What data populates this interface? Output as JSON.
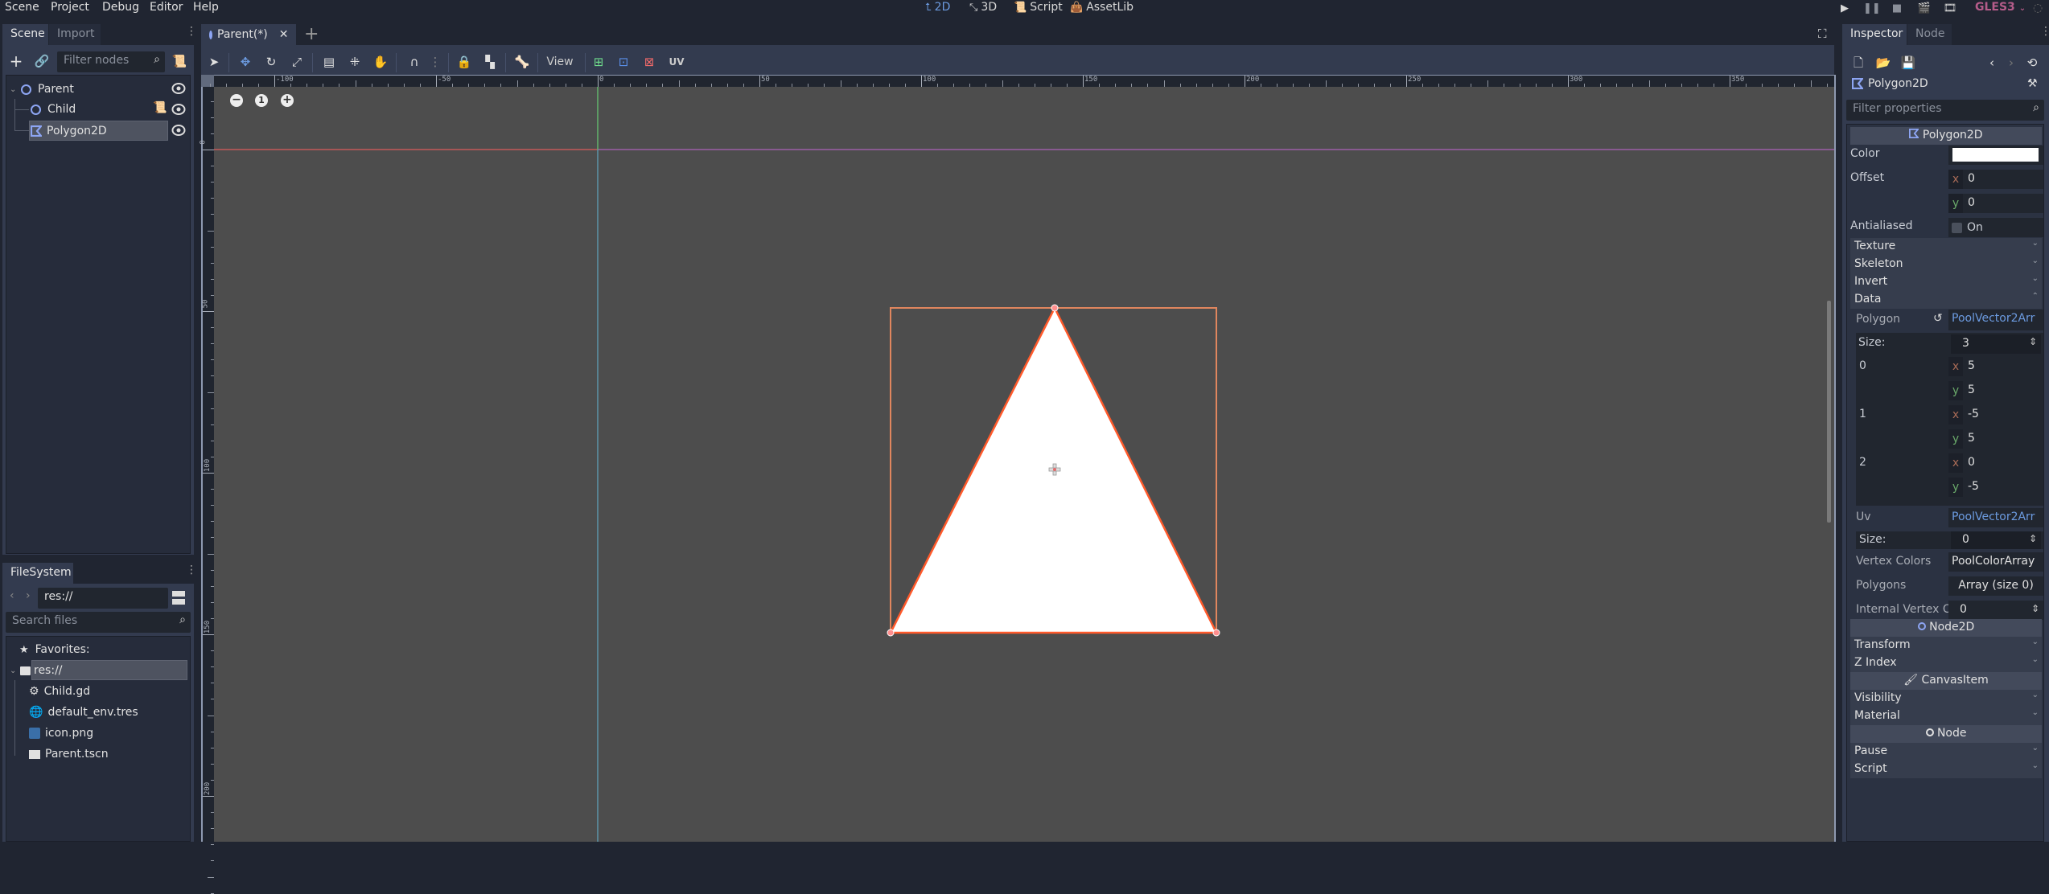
{
  "menubar": {
    "items": [
      "Scene",
      "Project",
      "Debug",
      "Editor",
      "Help"
    ],
    "modes": [
      {
        "label": "2D",
        "icon": "2d-icon",
        "active": true
      },
      {
        "label": "3D",
        "icon": "3d-icon",
        "active": false
      },
      {
        "label": "Script",
        "icon": "script-icon",
        "active": false
      },
      {
        "label": "AssetLib",
        "icon": "assetlib-icon",
        "active": false
      }
    ],
    "run_buttons": [
      "play-icon",
      "pause-icon",
      "stop-icon",
      "play-scene-icon",
      "play-custom-scene-icon"
    ],
    "renderer": "GLES3",
    "accent_color": "#6c9be0",
    "renderer_color": "#b55c8a"
  },
  "scene_dock": {
    "tabs": [
      "Scene",
      "Import"
    ],
    "active_tab": "Scene",
    "filter_placeholder": "Filter nodes",
    "tree": [
      {
        "name": "Parent",
        "type": "Node2D",
        "level": 0,
        "expanded": true,
        "has_script": false,
        "visible": true,
        "selected": false
      },
      {
        "name": "Child",
        "type": "Node2D",
        "level": 1,
        "has_script": true,
        "visible": true,
        "selected": false
      },
      {
        "name": "Polygon2D",
        "type": "Polygon2D",
        "level": 1,
        "has_script": false,
        "visible": true,
        "selected": true
      }
    ]
  },
  "filesystem_dock": {
    "tab": "FileSystem",
    "path": "res://",
    "search_placeholder": "Search files",
    "favorites_label": "Favorites:",
    "root": "res://",
    "files": [
      {
        "name": "Child.gd",
        "icon": "gear-icon"
      },
      {
        "name": "default_env.tres",
        "icon": "globe-icon"
      },
      {
        "name": "icon.png",
        "icon": "image-icon"
      },
      {
        "name": "Parent.tscn",
        "icon": "clapperboard-icon"
      }
    ]
  },
  "editor": {
    "scene_tab": "Parent(*)",
    "toolbar": {
      "view_label": "View",
      "uv_label": "UV"
    },
    "ruler_h_labels": [
      "-100",
      "-50",
      "0",
      "50",
      "100",
      "150",
      "200",
      "250",
      "300",
      "350"
    ],
    "ruler_v_labels": [
      "0",
      "50",
      "100",
      "150",
      "200"
    ],
    "zoom_controls": [
      "zoom-out",
      "zoom-reset",
      "zoom-in"
    ],
    "zoom_reset_label": "1",
    "polygon_fill": "#ffffff",
    "polygon_outline": "#ff5a2b",
    "selection_box": "#e0865e"
  },
  "inspector": {
    "tabs": [
      "Inspector",
      "Node"
    ],
    "active_tab": "Inspector",
    "object_name": "Polygon2D",
    "filter_placeholder": "Filter properties",
    "class_header": "Polygon2D",
    "color_label": "Color",
    "color_value": "#ffffff",
    "offset_label": "Offset",
    "offset": {
      "x": "0",
      "y": "0"
    },
    "antialiased_label": "Antialiased",
    "antialiased_value": "On",
    "antialiased_checked": false,
    "sections": [
      "Texture",
      "Skeleton",
      "Invert",
      "Data"
    ],
    "data": {
      "polygon_label": "Polygon",
      "polygon_value": "PoolVector2Arr",
      "size_label": "Size:",
      "size_value": "3",
      "points": [
        {
          "index": "0",
          "x": "5",
          "y": "5"
        },
        {
          "index": "1",
          "x": "-5",
          "y": "5"
        },
        {
          "index": "2",
          "x": "0",
          "y": "-5"
        }
      ],
      "uv_label": "Uv",
      "uv_value": "PoolVector2Arr",
      "uv_size_label": "Size:",
      "uv_size_value": "0",
      "vertex_colors_label": "Vertex Colors",
      "vertex_colors_value": "PoolColorArray",
      "polygons_label": "Polygons",
      "polygons_value": "Array (size 0)",
      "internal_vertex_label": "Internal Vertex C",
      "internal_vertex_value": "0"
    },
    "node2d_header": "Node2D",
    "node2d_sections": [
      "Transform",
      "Z Index"
    ],
    "canvasitem_header": "CanvasItem",
    "canvasitem_sections": [
      "Visibility",
      "Material"
    ],
    "node_header": "Node",
    "node_sections": [
      "Pause",
      "Script"
    ]
  }
}
